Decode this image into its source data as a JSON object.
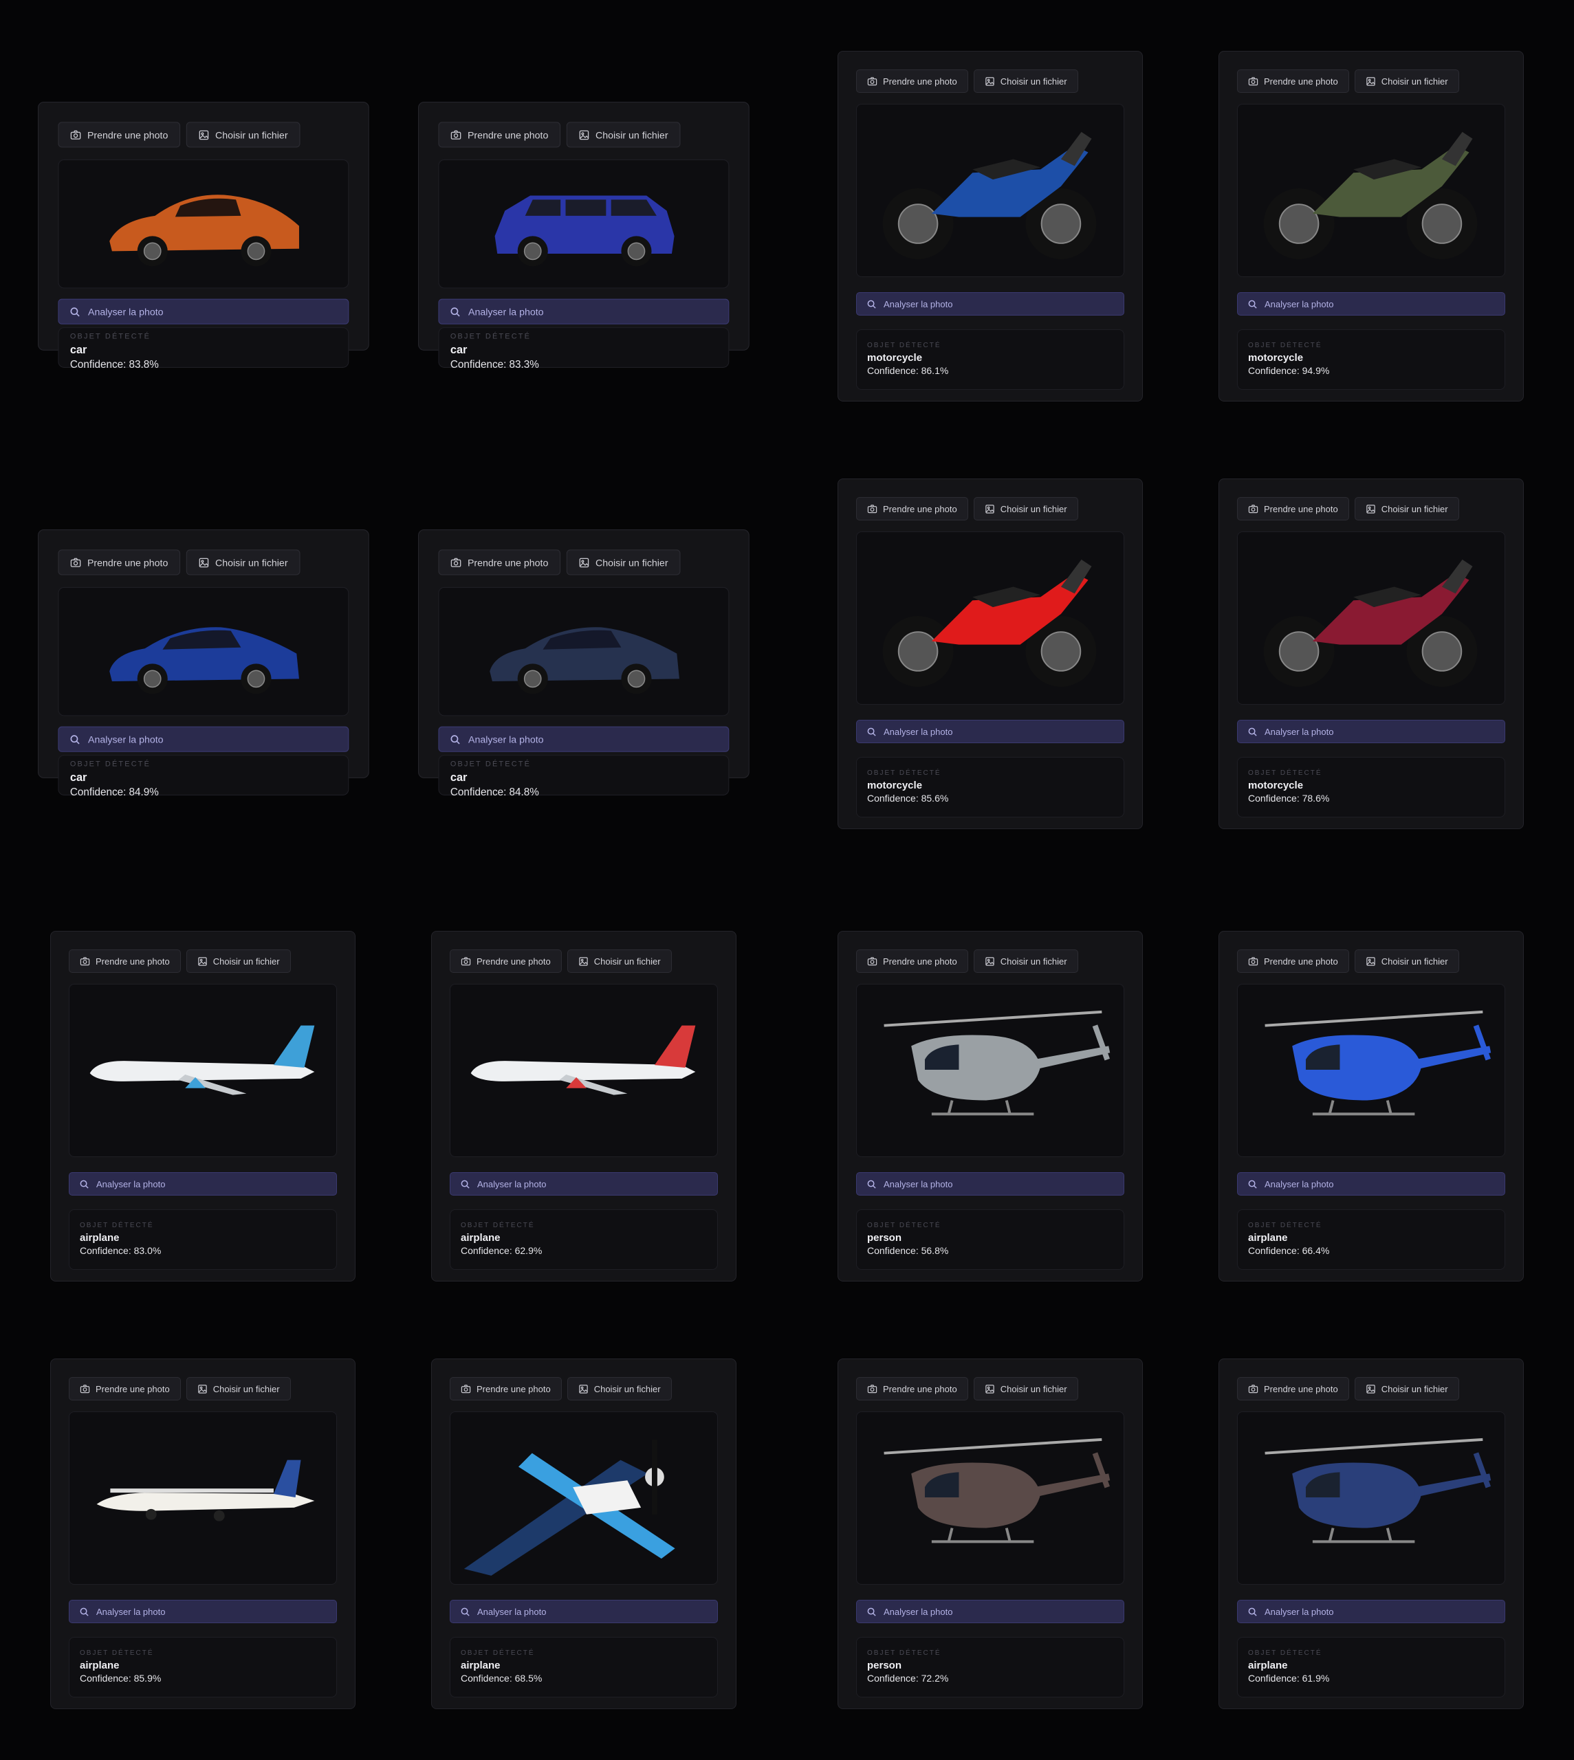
{
  "labels": {
    "take_photo": "Prendre une photo",
    "choose_file": "Choisir un fichier",
    "analyze": "Analyser la photo",
    "detected": "OBJET DÉTECTÉ"
  },
  "colors": {
    "background": "#050506",
    "card": "#141417",
    "accent": "#2b2a4d",
    "accent_text": "#b3b2e6"
  },
  "cards": [
    {
      "vehicle": "sports-car",
      "color": "#c85a1e",
      "object": "car",
      "confidence": "Confidence: 83.8%"
    },
    {
      "vehicle": "suv",
      "color": "#2a36a8",
      "object": "car",
      "confidence": "Confidence: 83.3%"
    },
    {
      "vehicle": "motorcycle",
      "color": "#1d4fa8",
      "object": "motorcycle",
      "confidence": "Confidence: 86.1%"
    },
    {
      "vehicle": "motorcycle",
      "color": "#4c5a3a",
      "object": "motorcycle",
      "confidence": "Confidence: 94.9%"
    },
    {
      "vehicle": "sedan",
      "color": "#1c3c9a",
      "object": "car",
      "confidence": "Confidence: 84.9%"
    },
    {
      "vehicle": "sedan",
      "color": "#26324f",
      "object": "car",
      "confidence": "Confidence: 84.8%"
    },
    {
      "vehicle": "motorcycle",
      "color": "#e01b1b",
      "object": "motorcycle",
      "confidence": "Confidence: 85.6%"
    },
    {
      "vehicle": "motorcycle",
      "color": "#8a1a32",
      "object": "motorcycle",
      "confidence": "Confidence: 78.6%"
    },
    {
      "vehicle": "airliner",
      "color": "#3ea0d8",
      "object": "airplane",
      "confidence": "Confidence: 83.0%"
    },
    {
      "vehicle": "airliner",
      "color": "#d83a3a",
      "object": "airplane",
      "confidence": "Confidence: 62.9%"
    },
    {
      "vehicle": "helicopter",
      "color": "#9aa0a4",
      "object": "person",
      "confidence": "Confidence: 56.8%"
    },
    {
      "vehicle": "helicopter",
      "color": "#2a5ad8",
      "object": "airplane",
      "confidence": "Confidence: 66.4%"
    },
    {
      "vehicle": "prop-plane",
      "color": "#2a4fa0",
      "object": "airplane",
      "confidence": "Confidence: 85.9%"
    },
    {
      "vehicle": "toy-plane",
      "color": "#3aa0e0",
      "object": "airplane",
      "confidence": "Confidence: 68.5%"
    },
    {
      "vehicle": "helicopter",
      "color": "#5a4a48",
      "object": "person",
      "confidence": "Confidence: 72.2%"
    },
    {
      "vehicle": "helicopter",
      "color": "#2a3f7a",
      "object": "airplane",
      "confidence": "Confidence: 61.9%"
    }
  ]
}
